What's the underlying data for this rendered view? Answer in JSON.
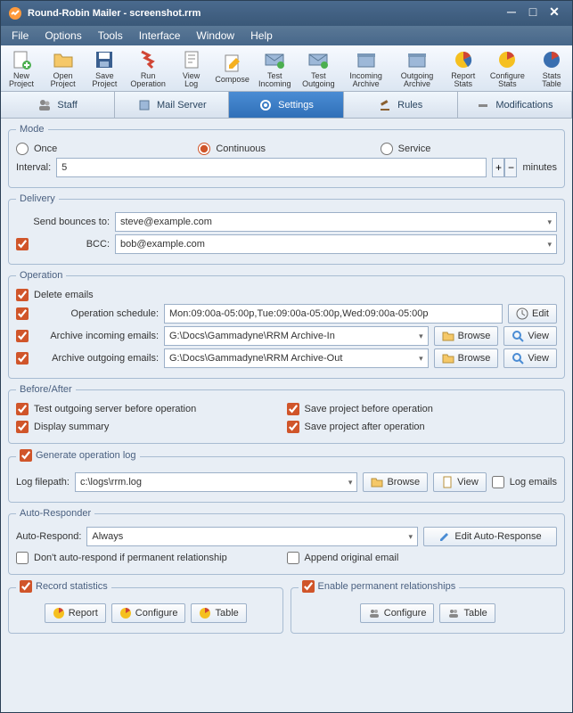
{
  "window": {
    "title": "Round-Robin Mailer - screenshot.rrm"
  },
  "menu": [
    "File",
    "Options",
    "Tools",
    "Interface",
    "Window",
    "Help"
  ],
  "toolbar": [
    {
      "label": "New Project"
    },
    {
      "label": "Open Project"
    },
    {
      "label": "Save Project"
    },
    {
      "label": "Run Operation"
    },
    {
      "label": "View Log"
    },
    {
      "label": "Compose"
    },
    {
      "label": "Test Incoming"
    },
    {
      "label": "Test Outgoing"
    },
    {
      "label": "Incoming Archive"
    },
    {
      "label": "Outgoing Archive"
    },
    {
      "label": "Report Stats"
    },
    {
      "label": "Configure Stats"
    },
    {
      "label": "Stats Table"
    }
  ],
  "tabs": [
    {
      "label": "Staff"
    },
    {
      "label": "Mail Server"
    },
    {
      "label": "Settings",
      "active": true
    },
    {
      "label": "Rules"
    },
    {
      "label": "Modifications"
    }
  ],
  "mode": {
    "legend": "Mode",
    "options": [
      "Once",
      "Continuous",
      "Service"
    ],
    "selected": "Continuous",
    "interval_label": "Interval:",
    "interval_value": "5",
    "interval_unit": "minutes"
  },
  "delivery": {
    "legend": "Delivery",
    "bounce_label": "Send bounces to:",
    "bounce_value": "steve@example.com",
    "bcc_label": "BCC:",
    "bcc_checked": true,
    "bcc_value": "bob@example.com"
  },
  "operation": {
    "legend": "Operation",
    "delete_label": "Delete emails",
    "delete_checked": true,
    "schedule_label": "Operation schedule:",
    "schedule_checked": true,
    "schedule_value": "Mon:09:00a-05:00p,Tue:09:00a-05:00p,Wed:09:00a-05:00p",
    "edit_btn": "Edit",
    "arch_in_label": "Archive incoming emails:",
    "arch_in_checked": true,
    "arch_in_value": "G:\\Docs\\Gammadyne\\RRM Archive-In",
    "arch_out_label": "Archive outgoing emails:",
    "arch_out_checked": true,
    "arch_out_value": "G:\\Docs\\Gammadyne\\RRM Archive-Out",
    "browse_btn": "Browse",
    "view_btn": "View"
  },
  "before_after": {
    "legend": "Before/After",
    "test_server": "Test outgoing server before operation",
    "save_before": "Save project before operation",
    "summary": "Display summary",
    "save_after": "Save project after operation"
  },
  "log": {
    "gen_label": "Generate operation log",
    "gen_checked": true,
    "filepath_label": "Log filepath:",
    "filepath_value": "c:\\logs\\rrm.log",
    "browse_btn": "Browse",
    "view_btn": "View",
    "log_emails": "Log emails"
  },
  "autorespond": {
    "legend": "Auto-Responder",
    "mode_label": "Auto-Respond:",
    "mode_value": "Always",
    "edit_btn": "Edit Auto-Response",
    "dont_label": "Don't auto-respond if permanent relationship",
    "append_label": "Append original email"
  },
  "stats": {
    "legend": "Record statistics",
    "checked": true,
    "report_btn": "Report",
    "configure_btn": "Configure",
    "table_btn": "Table"
  },
  "relationships": {
    "legend": "Enable permanent relationships",
    "checked": true,
    "configure_btn": "Configure",
    "table_btn": "Table"
  }
}
